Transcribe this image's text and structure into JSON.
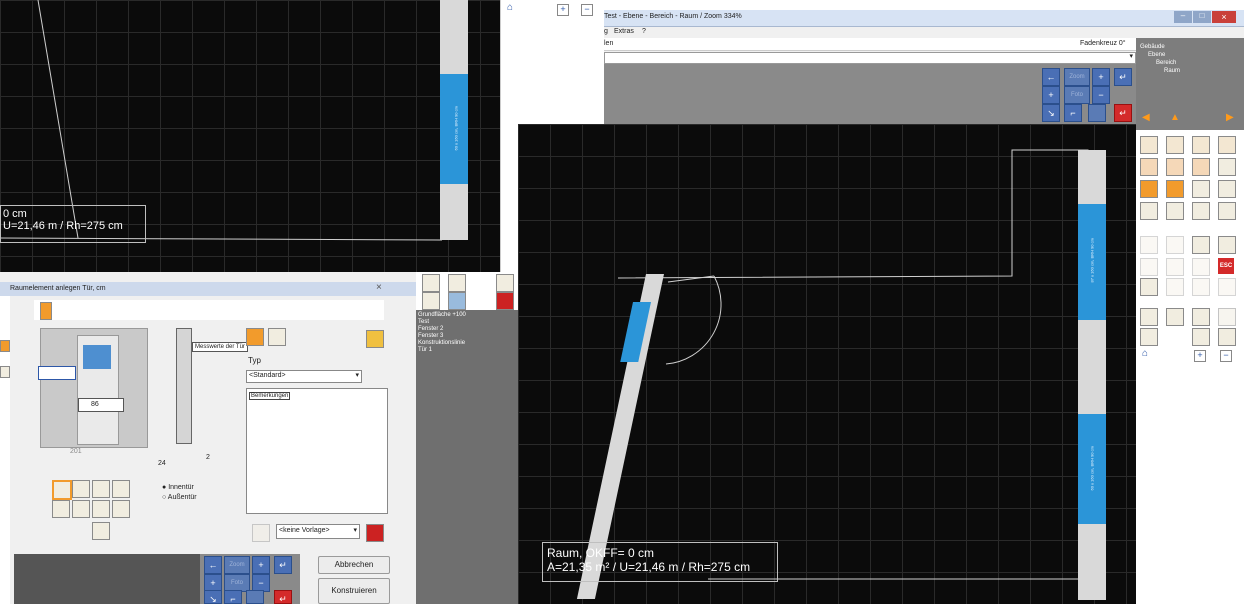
{
  "main_window": {
    "title": "Test - Ebene - Bereich - Raum / Zoom 334%",
    "menu": [
      "g",
      "Extras",
      "?"
    ],
    "toolbar_left_label": "len",
    "crosshair_label": "Fadenkreuz 0°",
    "tree": [
      "Gebäude",
      "Ebene",
      "Bereich",
      "Raum"
    ],
    "win_buttons": {
      "min": "–",
      "max": "□",
      "close": "×"
    }
  },
  "room_info": {
    "line1": "Raum, OKFF= 0 cm",
    "line2": "A=21,35 m² / U=21,46 m / Rh=275 cm"
  },
  "top_left_info": {
    "line1": "0 cm",
    "line2": "U=21,46 m / Rh=275 cm"
  },
  "object_list": [
    "Grundfläche +100",
    "Test",
    "Fenster 2",
    "Fenster 3",
    "Konstruktionslinie",
    "Tür 1"
  ],
  "dialog": {
    "title": "Raumelement anlegen Tür, cm",
    "tooltip": "Messwerte der Tür",
    "typ_label": "Typ",
    "typ_value": "<Standard>",
    "remarks": "Bemerkungen",
    "width_value": "86",
    "dim_201": "201",
    "dim_24": "24",
    "dim_2": "2",
    "radio_inner": "Innentür",
    "radio_outer": "Außentür",
    "template": "<keine Vorlage>",
    "cancel": "Abbrechen",
    "construct": "Konstruieren"
  },
  "nav_labels": {
    "zoom": "Zoom",
    "photo": "Foto",
    "esc": "ESC"
  },
  "wall_window_labels": {
    "a": "60 x 160 cm, BRH 90 cm",
    "b": "87 x 160 cm, BRH 90 cm",
    "c": "60 x 160 cm, BRH 90 cm"
  }
}
